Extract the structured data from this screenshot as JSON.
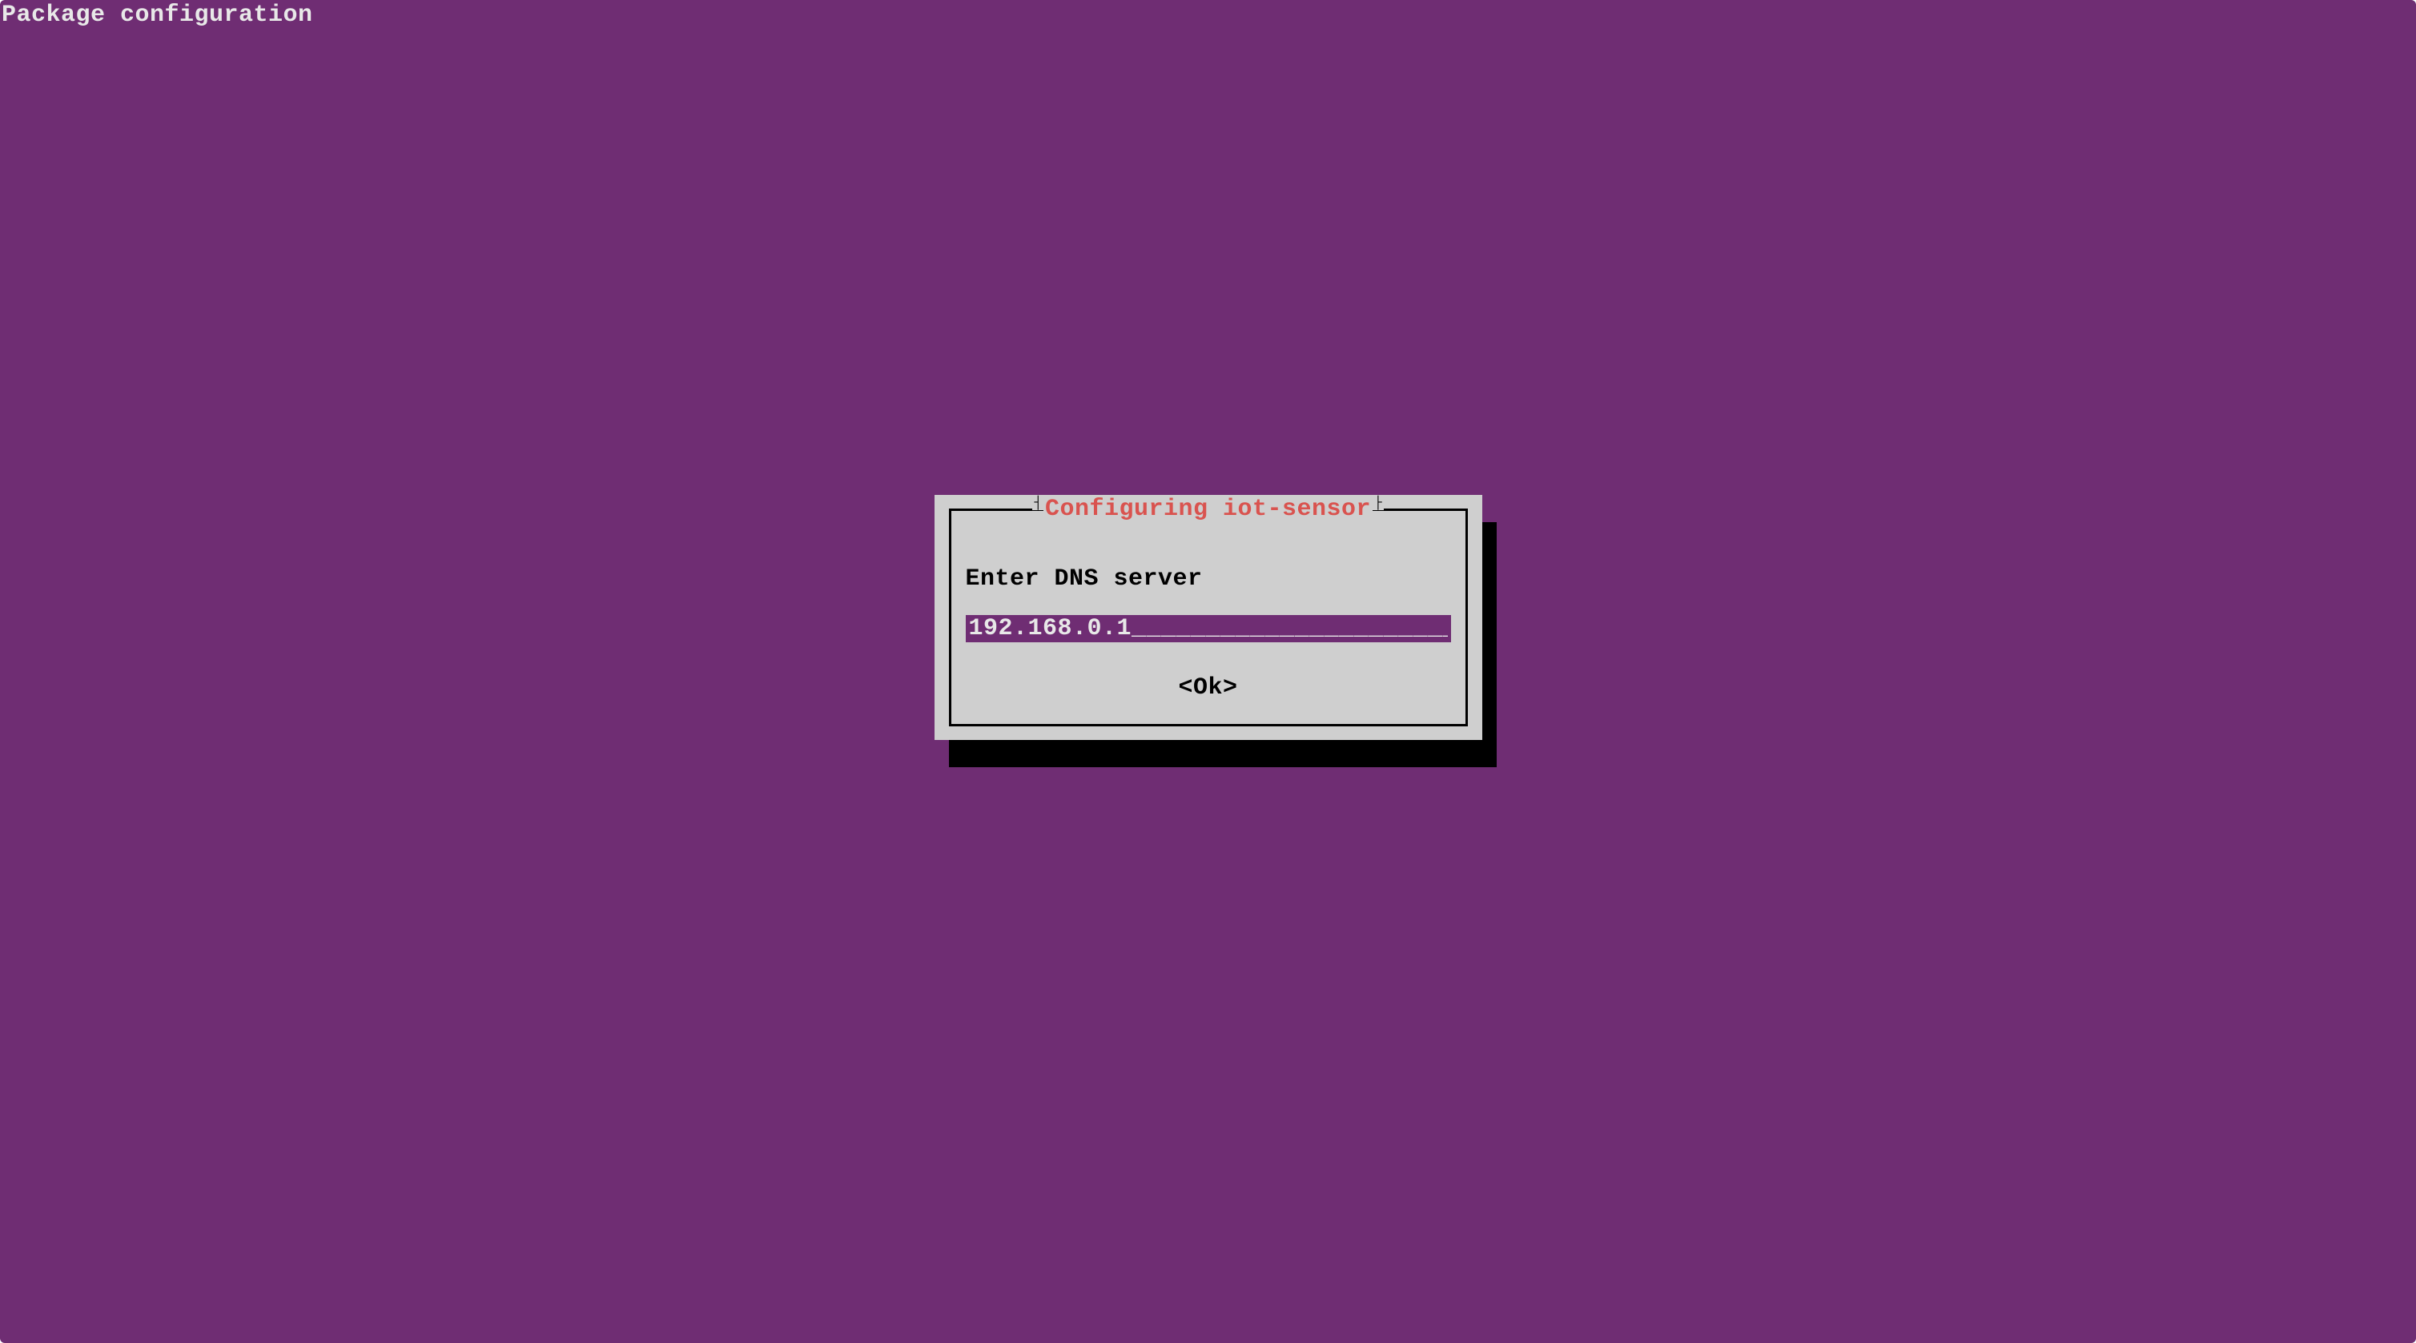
{
  "header": {
    "title": "Package configuration"
  },
  "dialog": {
    "title_text": "Configuring iot-sensor",
    "title_left_glyph": "┤ ",
    "title_right_glyph": " ├",
    "prompt": "Enter DNS server",
    "input": {
      "value": "192.168.0.1",
      "width_chars": 34,
      "fill_char": "_"
    },
    "ok_label": "<Ok>"
  },
  "colors": {
    "background": "#6f2d73",
    "panel": "#cfcfcf",
    "shadow": "#000000",
    "title": "#d9534f",
    "header_text": "#e8e8e8",
    "input_bg": "#6f2d73",
    "input_fg": "#e8e8e8"
  }
}
